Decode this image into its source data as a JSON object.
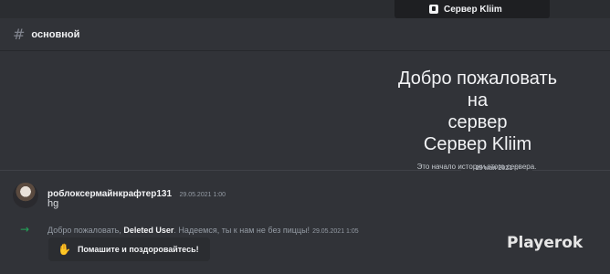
{
  "server_tab": {
    "icon": "server-icon",
    "label": "Сервер Kliim"
  },
  "channel": {
    "icon": "hash-icon",
    "name": "основной"
  },
  "welcome": {
    "title_line1": "Добро пожаловать на",
    "title_line2": "сервер",
    "title_line3": "Сервер Kliim",
    "subtitle": "Это начало истории этого сервера."
  },
  "date_divider": "29 мая 2021 г.",
  "message": {
    "author": "роблоксермайнкрафтер131",
    "timestamp": "29.05.2021 1:00",
    "text": "hg"
  },
  "join_message": {
    "icon": "arrow-right-icon",
    "prefix": "Добро пожаловать,",
    "user": "Deleted User",
    "suffix": ". Надеемся, ты к нам не без пиццы!",
    "timestamp": "29.05.2021 1:05"
  },
  "wave_button": {
    "icon": "wave-icon",
    "label": "Помашите и поздоровайтесь!"
  },
  "watermark": "Playerok",
  "colors": {
    "background": "#313338",
    "join_arrow": "#23a55a",
    "text": "#dbdee1"
  }
}
